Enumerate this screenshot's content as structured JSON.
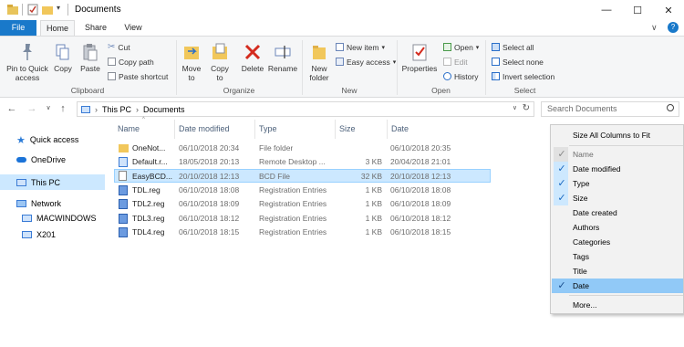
{
  "window": {
    "title": "Documents",
    "controls": [
      "—",
      "☐",
      "✕"
    ]
  },
  "ribbon": {
    "tabs": [
      "File",
      "Home",
      "Share",
      "View"
    ],
    "groups": {
      "clipboard": {
        "label": "Clipboard",
        "pin_label_1": "Pin to Quick",
        "pin_label_2": "access",
        "copy": "Copy",
        "paste": "Paste",
        "cut": "Cut",
        "copy_path": "Copy path",
        "paste_shortcut": "Paste shortcut"
      },
      "organize": {
        "label": "Organize",
        "move_to": "Move",
        "move_to_2": "to",
        "copy_to": "Copy",
        "copy_to_2": "to",
        "delete": "Delete",
        "rename": "Rename"
      },
      "new": {
        "label": "New",
        "new_folder": "New",
        "new_folder_2": "folder",
        "new_item": "New item",
        "easy_access": "Easy access"
      },
      "open": {
        "label": "Open",
        "properties": "Properties",
        "open": "Open",
        "edit": "Edit",
        "history": "History"
      },
      "select": {
        "label": "Select",
        "select_all": "Select all",
        "select_none": "Select none",
        "invert_selection": "Invert selection"
      }
    }
  },
  "address": {
    "crumbs": [
      "This PC",
      "Documents"
    ],
    "search_placeholder": "Search Documents"
  },
  "nav_pane": {
    "items": [
      "Quick access",
      "OneDrive",
      "This PC",
      "Network",
      "MACWINDOWS",
      "X201"
    ]
  },
  "file_list": {
    "columns": [
      "Name",
      "Date modified",
      "Type",
      "Size",
      "Date"
    ],
    "rows": [
      {
        "name": "OneNot...",
        "modified": "06/10/2018 20:34",
        "type": "File folder",
        "size": "",
        "date": "06/10/2018 20:35"
      },
      {
        "name": "Default.r...",
        "modified": "18/05/2018 20:13",
        "type": "Remote Desktop ...",
        "size": "3 KB",
        "date": "20/04/2018 21:01"
      },
      {
        "name": "EasyBCD...",
        "modified": "20/10/2018 12:13",
        "type": "BCD File",
        "size": "32 KB",
        "date": "20/10/2018 12:13"
      },
      {
        "name": "TDL.reg",
        "modified": "06/10/2018 18:08",
        "type": "Registration Entries",
        "size": "1 KB",
        "date": "06/10/2018 18:08"
      },
      {
        "name": "TDL2.reg",
        "modified": "06/10/2018 18:09",
        "type": "Registration Entries",
        "size": "1 KB",
        "date": "06/10/2018 18:09"
      },
      {
        "name": "TDL3.reg",
        "modified": "06/10/2018 18:12",
        "type": "Registration Entries",
        "size": "1 KB",
        "date": "06/10/2018 18:12"
      },
      {
        "name": "TDL4.reg",
        "modified": "06/10/2018 18:15",
        "type": "Registration Entries",
        "size": "1 KB",
        "date": "06/10/2018 18:15"
      }
    ]
  },
  "context_menu": {
    "size_all": "Size All Columns to Fit",
    "items": [
      {
        "label": "Name",
        "checked": true,
        "disabled": true
      },
      {
        "label": "Date modified",
        "checked": true
      },
      {
        "label": "Type",
        "checked": true
      },
      {
        "label": "Size",
        "checked": true
      },
      {
        "label": "Date created",
        "checked": false
      },
      {
        "label": "Authors",
        "checked": false
      },
      {
        "label": "Categories",
        "checked": false
      },
      {
        "label": "Tags",
        "checked": false
      },
      {
        "label": "Title",
        "checked": false
      },
      {
        "label": "Date",
        "checked": true,
        "highlighted": true
      }
    ],
    "more": "More..."
  },
  "colors": {
    "accent": "#1979ca",
    "selection": "#cce8ff",
    "menu_highlight": "#91c9f7"
  }
}
